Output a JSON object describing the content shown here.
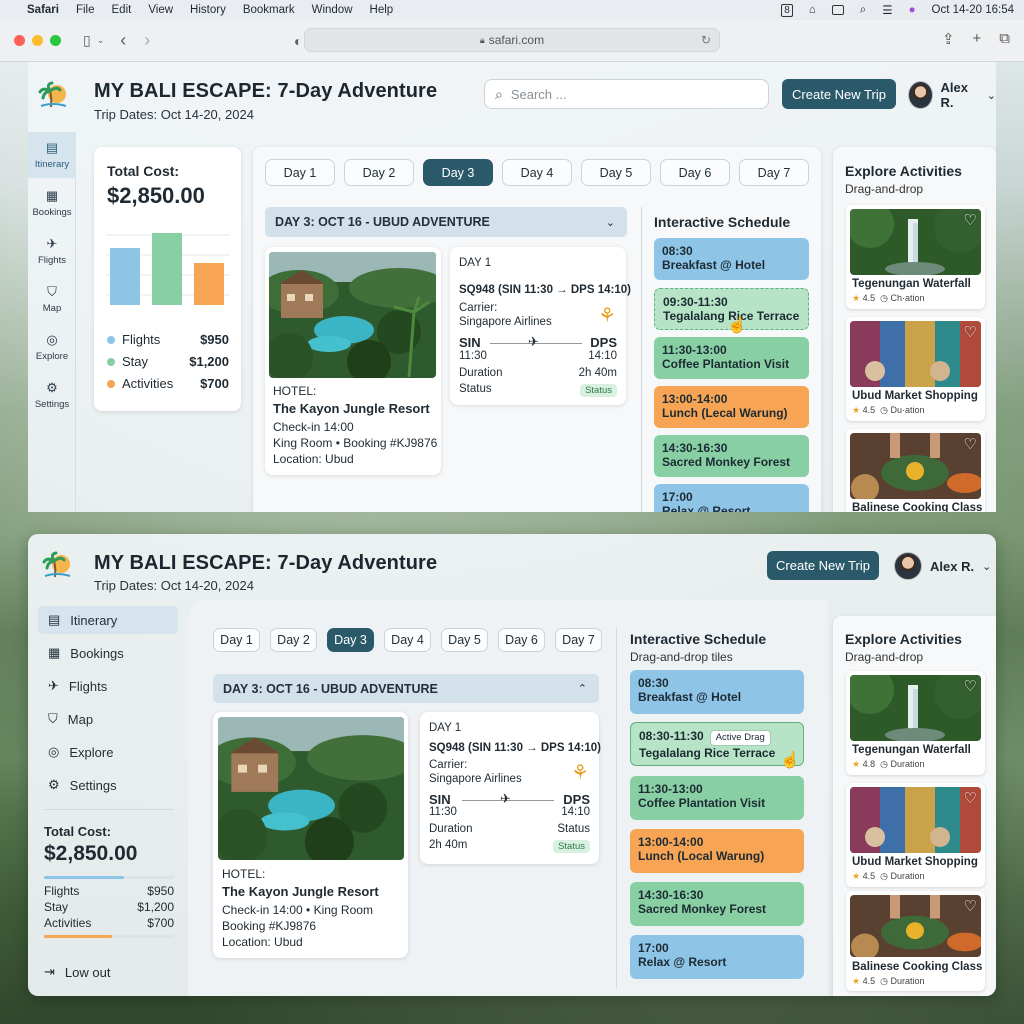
{
  "menubar": {
    "app": "Safari",
    "items": [
      "File",
      "Edit",
      "View",
      "History",
      "Bookmark",
      "Window",
      "Help"
    ],
    "clock": "Oct 14-20  16:54"
  },
  "browser": {
    "url": "safari.com"
  },
  "trip": {
    "title": "MY BALI ESCAPE: 7-Day Adventure",
    "dates": "Trip Dates: Oct 14-20, 2024"
  },
  "search": {
    "placeholder": "Search ..."
  },
  "header": {
    "create_label": "Create New Trip",
    "user_name": "Alex R."
  },
  "nav": {
    "itinerary": "Itinerary",
    "bookings": "Bookings",
    "flights": "Flights",
    "map": "Map",
    "explore": "Explore",
    "settings": "Settings",
    "logout": "Low out"
  },
  "cost": {
    "label": "Total Cost:",
    "total": "$2,850.00",
    "flights_label": "Flights",
    "flights_value": "$950",
    "stay_label": "Stay",
    "stay_value": "$1,200",
    "activities_label": "Activities",
    "activities_value": "$700",
    "chart_values": [
      950,
      1200,
      700
    ],
    "colors": {
      "flights": "#8ec4e6",
      "stay": "#88cfa4",
      "activities": "#f7a454"
    }
  },
  "days": [
    "Day 1",
    "Day 2",
    "Day 3",
    "Day 4",
    "Day 5",
    "Day 6",
    "Day 7"
  ],
  "day_header": "DAY 3: OCT 16 - UBUD ADVENTURE",
  "hotel": {
    "label": "HOTEL:",
    "name": "The Kayon Jungle Resort",
    "checkin": "Check-in 14:00",
    "room_booking": "King Room • Booking #KJ9876",
    "location": "Location: Ubud",
    "checkin_room": "Check-in 14:00  •  King Room",
    "booking": "Booking #KJ9876"
  },
  "flight": {
    "day": "DAY 1",
    "number": "SQ948 (SIN 11:30 → DPS 14:10)",
    "carrier_label": "Carrier:",
    "carrier": "Singapore Airlines",
    "from": "SIN",
    "to": "DPS",
    "dep": "11:30",
    "arr": "14:10",
    "duration_label": "Duration",
    "duration": "2h 40m",
    "status_label": "Status",
    "status": "Status"
  },
  "schedule": {
    "title": "Interactive Schedule",
    "subtitle": "Drag-and-drop tiles",
    "drag_badge": "Active Drag",
    "top": [
      {
        "time": "08:30",
        "name": "Breakfast @ Hotel"
      },
      {
        "time": "09:30-11:30",
        "name": "Tegalalang Rice Terrace"
      },
      {
        "time": "11:30-13:00",
        "name": "Coffee Plantation Visit"
      },
      {
        "time": "13:00-14:00",
        "name": "Lunch (Lecal Warung)"
      },
      {
        "time": "14:30-16:30",
        "name": "Sacred Monkey Forest"
      },
      {
        "time": "17:00",
        "name": "Relax @ Resort"
      }
    ],
    "bottom": [
      {
        "time": "08:30",
        "name": "Breakfast @ Hotel"
      },
      {
        "time": "08:30-11:30",
        "name": "Tegalalang Rice Terrace"
      },
      {
        "time": "11:30-13:00",
        "name": "Coffee Plantation Visit"
      },
      {
        "time": "13:00-14:00",
        "name": "Lunch (Local Warung)"
      },
      {
        "time": "14:30-16:30",
        "name": "Sacred Monkey Forest"
      },
      {
        "time": "17:00",
        "name": "Relax @ Resort"
      }
    ]
  },
  "explore": {
    "title": "Explore Activities",
    "subtitle": "Drag-and-drop",
    "activities_top": [
      {
        "name": "Tegenungan Waterfall",
        "rating": "4.5",
        "meta": "Ch·ation"
      },
      {
        "name": "Ubud Market Shopping",
        "rating": "4.5",
        "meta": "Du·ation"
      },
      {
        "name": "Balinese Cooking Class",
        "rating": "4.5",
        "meta": "Duration"
      }
    ],
    "activities_bottom": [
      {
        "name": "Tegenungan Waterfall",
        "rating": "4.8",
        "meta": "Duration"
      },
      {
        "name": "Ubud Market Shopping",
        "rating": "4.5",
        "meta": "Duration"
      },
      {
        "name": "Balinese Cooking Class",
        "rating": "4.5",
        "meta": "Duration"
      }
    ]
  }
}
